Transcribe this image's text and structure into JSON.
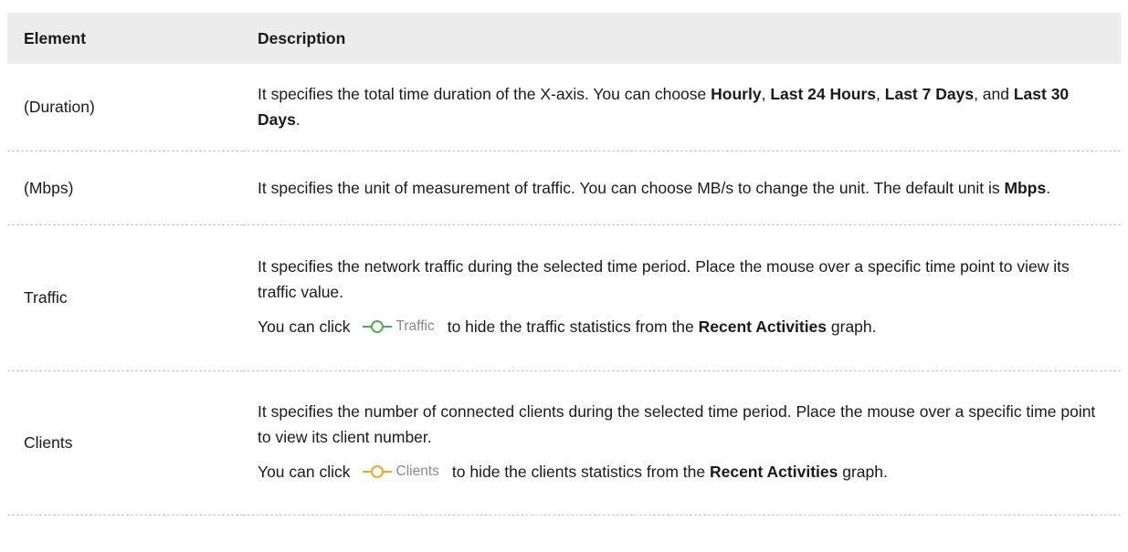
{
  "table": {
    "headers": [
      "Element",
      "Description"
    ],
    "rows": [
      {
        "element": "(Duration)",
        "desc": {
          "t1": "It specifies the total time duration of the X-axis. You can choose ",
          "b1": "Hourly",
          "t2": ", ",
          "b2": "Last 24 Hours",
          "t3": ", ",
          "b3": "Last 7 Days",
          "t4": ", and ",
          "b4": "Last 30 Days",
          "t5": "."
        }
      },
      {
        "element": "(Mbps)",
        "desc": {
          "t1": "It specifies the unit of measurement of traffic. You can choose MB/s to change the unit. The default unit is ",
          "b1": "Mbps",
          "t2": "."
        }
      },
      {
        "element": "Traffic",
        "desc": {
          "p1": "It specifies the network traffic during the selected time period. Place the mouse over a specific time point to view its traffic value.",
          "p2_t1": "You can click",
          "legend_label": "Traffic",
          "legend_color": "#4caf50",
          "p2_t2": "to hide the traffic statistics from the ",
          "p2_b1": "Recent Activities",
          "p2_t3": " graph."
        }
      },
      {
        "element": "Clients",
        "desc": {
          "p1": "It specifies the number of connected clients during the selected time period. Place the mouse over a specific time point to view its client number.",
          "p2_t1": "You can click",
          "legend_label": "Clients",
          "legend_color": "#f5a623",
          "p2_t2": "to hide the clients statistics from the ",
          "p2_b1": "Recent Activities",
          "p2_t3": " graph."
        }
      }
    ]
  },
  "icons": {
    "traffic_legend": "green-line-circle-icon",
    "clients_legend": "orange-line-circle-icon"
  }
}
